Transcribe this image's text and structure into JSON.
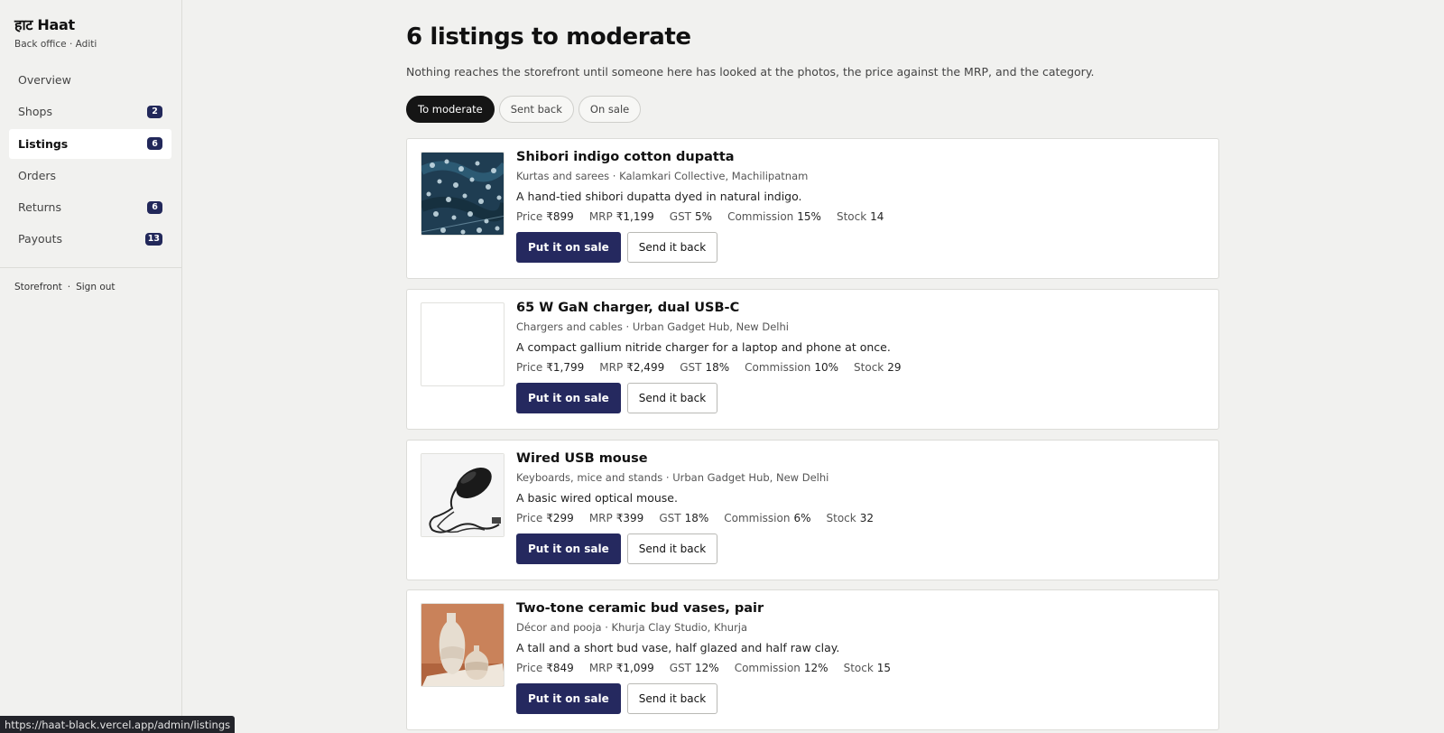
{
  "brand": {
    "name": "हाट Haat",
    "subtitle": "Back office · Aditi"
  },
  "sidebar": {
    "items": [
      {
        "label": "Overview",
        "badge": null
      },
      {
        "label": "Shops",
        "badge": "2"
      },
      {
        "label": "Listings",
        "badge": "6",
        "active": true
      },
      {
        "label": "Orders",
        "badge": null
      },
      {
        "label": "Returns",
        "badge": "6"
      },
      {
        "label": "Payouts",
        "badge": "13"
      }
    ],
    "footer": {
      "storefront": "Storefront",
      "separator": "·",
      "signout": "Sign out"
    }
  },
  "page": {
    "title": "6 listings to moderate",
    "lead": "Nothing reaches the storefront until someone here has looked at the photos, the price against the MRP, and the category.",
    "tabs": [
      {
        "label": "To moderate",
        "active": true
      },
      {
        "label": "Sent back",
        "active": false
      },
      {
        "label": "On sale",
        "active": false
      }
    ]
  },
  "stat_labels": {
    "price": "Price",
    "mrp": "MRP",
    "gst": "GST",
    "commission": "Commission",
    "stock": "Stock"
  },
  "actions": {
    "approve": "Put it on sale",
    "reject": "Send it back"
  },
  "listings": [
    {
      "title": "Shibori indigo cotton dupatta",
      "meta": "Kurtas and sarees · Kalamkari Collective, Machilipatnam",
      "desc": "A hand-tied shibori dupatta dyed in natural indigo.",
      "price": "₹899",
      "mrp": "₹1,199",
      "gst": "5%",
      "commission": "15%",
      "stock": "14",
      "image": "shibori-fabric"
    },
    {
      "title": "65 W GaN charger, dual USB-C",
      "meta": "Chargers and cables · Urban Gadget Hub, New Delhi",
      "desc": "A compact gallium nitride charger for a laptop and phone at once.",
      "price": "₹1,799",
      "mrp": "₹2,499",
      "gst": "18%",
      "commission": "10%",
      "stock": "29",
      "image": "blank"
    },
    {
      "title": "Wired USB mouse",
      "meta": "Keyboards, mice and stands · Urban Gadget Hub, New Delhi",
      "desc": "A basic wired optical mouse.",
      "price": "₹299",
      "mrp": "₹399",
      "gst": "18%",
      "commission": "6%",
      "stock": "32",
      "image": "black-mouse"
    },
    {
      "title": "Two-tone ceramic bud vases, pair",
      "meta": "Décor and pooja · Khurja Clay Studio, Khurja",
      "desc": "A tall and a short bud vase, half glazed and half raw clay.",
      "price": "₹849",
      "mrp": "₹1,099",
      "gst": "12%",
      "commission": "12%",
      "stock": "15",
      "image": "ceramic-vases"
    }
  ],
  "status_bar": {
    "url": "https://haat-black.vercel.app/admin/listings"
  }
}
